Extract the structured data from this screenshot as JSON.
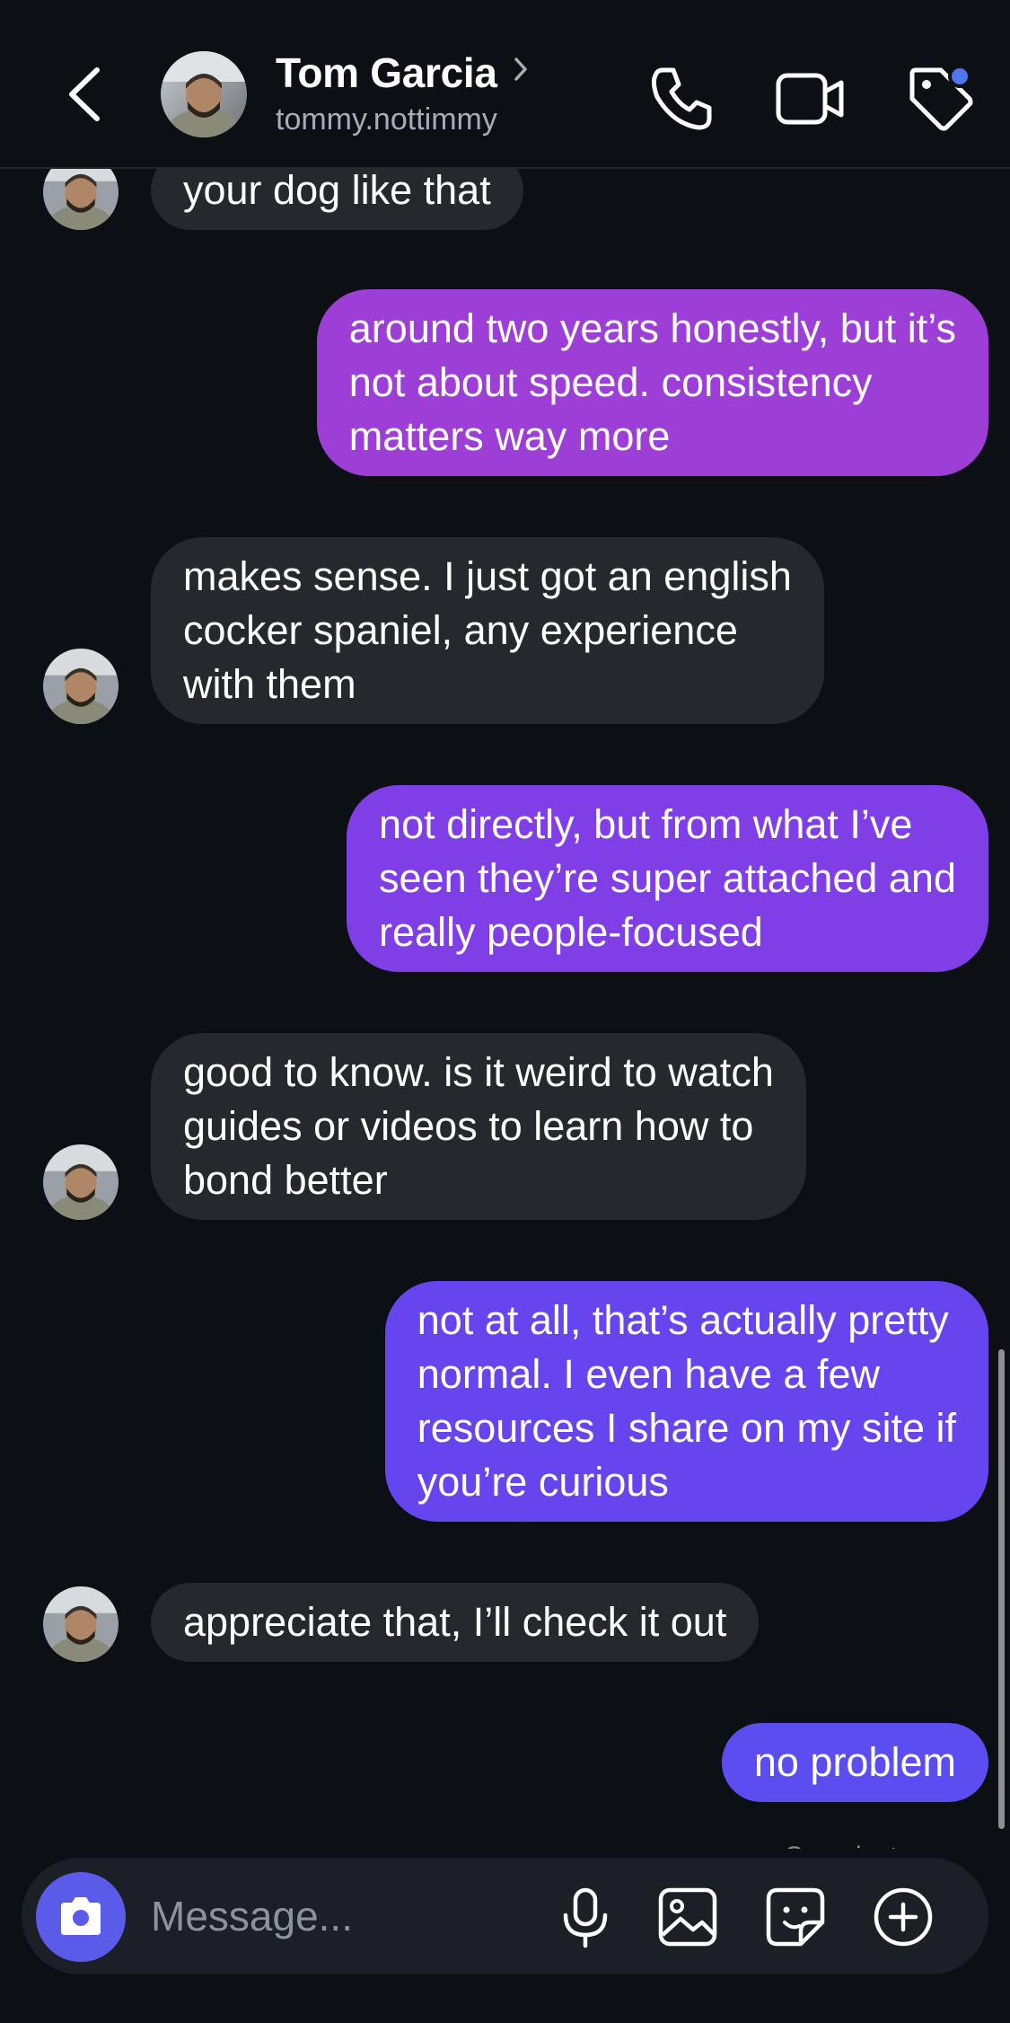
{
  "header": {
    "back_icon": "chevron-left-icon",
    "contact_name": "Tom Garcia",
    "contact_username": "tommy.nottimmy",
    "actions": [
      "phone-icon",
      "video-camera-icon",
      "tag-icon"
    ],
    "notification_dot_color": "#4f76f6"
  },
  "messages": [
    {
      "sender": "them",
      "text_lines": [
        "your dog like that"
      ]
    },
    {
      "sender": "me",
      "text_lines": [
        "around two years honestly, but it’s",
        "not about speed. consistency",
        "matters way more"
      ],
      "color": "#9d3fd6"
    },
    {
      "sender": "them",
      "text_lines": [
        "makes sense. I just got an english",
        "cocker spaniel, any experience",
        "with them"
      ]
    },
    {
      "sender": "me",
      "text_lines": [
        "not directly, but from what I’ve",
        "seen they’re super attached and",
        "really people-focused"
      ],
      "color": "#7f3ee6"
    },
    {
      "sender": "them",
      "text_lines": [
        "good to know. is it weird to watch",
        "guides or videos to learn how to",
        "bond better"
      ]
    },
    {
      "sender": "me",
      "text_lines": [
        "not at all, that’s actually pretty",
        "normal. I even have a few",
        "resources I share on my site if",
        "you’re curious"
      ],
      "color": "#6645ee"
    },
    {
      "sender": "them",
      "text_lines": [
        "appreciate that, I’ll check it out"
      ]
    },
    {
      "sender": "me",
      "text_lines": [
        "no problem"
      ],
      "color": "#5b4df0"
    }
  ],
  "seen_status": "Seen just now",
  "composer": {
    "placeholder": "Message...",
    "camera_button_color": "#5b5bea",
    "icons": [
      "microphone-icon",
      "gallery-icon",
      "sticker-icon",
      "plus-circle-icon"
    ]
  },
  "colors": {
    "background": "#0c0f14",
    "incoming_bubble": "#26282d",
    "outgoing_gradient_top": "#9d3fd6",
    "outgoing_gradient_bottom": "#5b4df0"
  }
}
